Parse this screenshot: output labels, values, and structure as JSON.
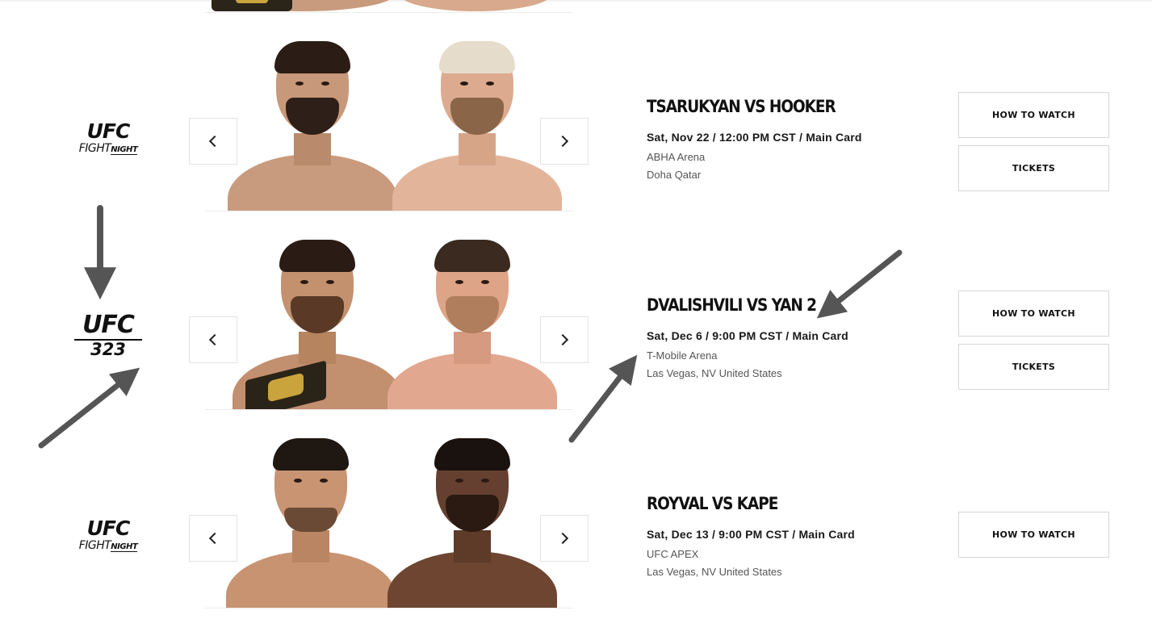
{
  "events": [
    {
      "logo": {
        "line1": "UFC",
        "line2a": "FIGHT",
        "line2b": "NIGHT",
        "number": ""
      },
      "title": "TSARUKYAN VS HOOKER",
      "date": "Sat, Nov 22 / 12:00 PM CST / Main Card",
      "venue": "ABHA Arena",
      "location": "Doha Qatar",
      "how_to_watch": "HOW TO WATCH",
      "tickets": "TICKETS"
    },
    {
      "logo": {
        "line1": "UFC",
        "number": "323"
      },
      "title": "DVALISHVILI VS YAN 2",
      "date": "Sat, Dec 6 / 9:00 PM CST / Main Card",
      "venue": "T-Mobile Arena",
      "location": "Las Vegas, NV United States",
      "how_to_watch": "HOW TO WATCH",
      "tickets": "TICKETS"
    },
    {
      "logo": {
        "line1": "UFC",
        "line2a": "FIGHT",
        "line2b": "NIGHT",
        "number": ""
      },
      "title": "ROYVAL VS KAPE",
      "date": "Sat, Dec 13 / 9:00 PM CST / Main Card",
      "venue": "UFC APEX",
      "location": "Las Vegas, NV United States",
      "how_to_watch": "HOW TO WATCH"
    }
  ],
  "icons": {
    "prev": "chevron-left-icon",
    "next": "chevron-right-icon"
  },
  "colors": {
    "annotation_arrow": "#555555",
    "button_border": "#d6d6d6",
    "text_primary": "#111111",
    "text_secondary": "#555555"
  }
}
